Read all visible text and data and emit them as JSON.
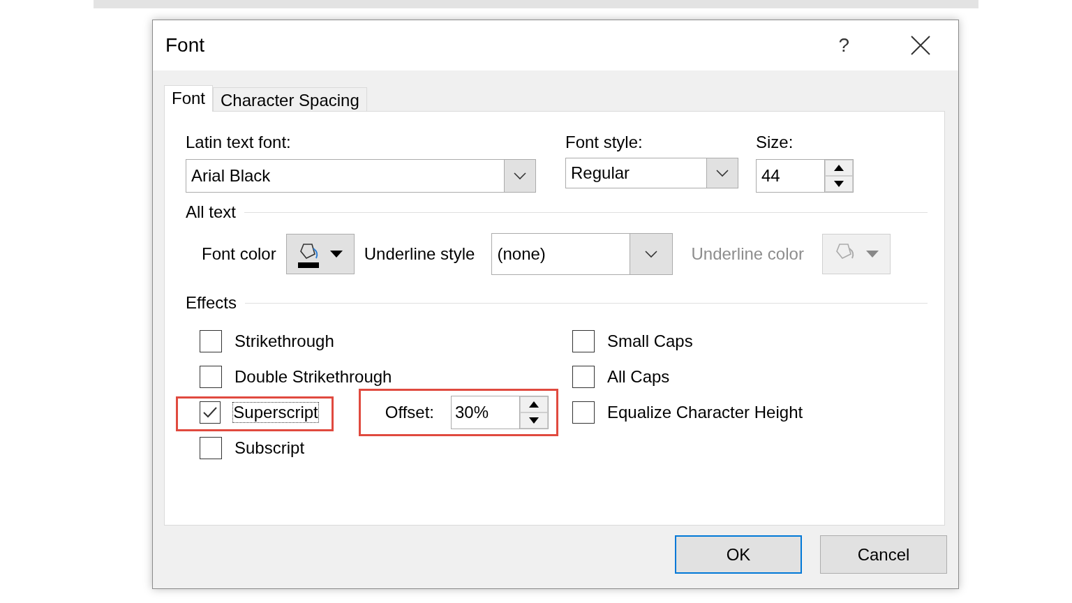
{
  "window": {
    "title": "Font",
    "help": "?"
  },
  "tabs": [
    {
      "label": "Font",
      "selected": true
    },
    {
      "label": "Character Spacing",
      "selected": false
    }
  ],
  "font": {
    "latin_label": "Latin text font:",
    "latin_value": "Arial Black",
    "style_label": "Font style:",
    "style_value": "Regular",
    "size_label": "Size:",
    "size_value": "44"
  },
  "all_text": {
    "heading": "All text",
    "font_color_label": "Font color",
    "underline_style_label": "Underline style",
    "underline_style_value": "(none)",
    "underline_color_label": "Underline color",
    "underline_color_disabled": true
  },
  "effects": {
    "heading": "Effects",
    "left": [
      {
        "label": "Strikethrough",
        "checked": false,
        "highlighted": false
      },
      {
        "label": "Double Strikethrough",
        "checked": false,
        "highlighted": false
      },
      {
        "label": "Superscript",
        "checked": true,
        "highlighted": true,
        "offset": {
          "label": "Offset:",
          "value": "30%",
          "highlighted": true
        }
      },
      {
        "label": "Subscript",
        "checked": false,
        "highlighted": false
      }
    ],
    "right": [
      {
        "label": "Small Caps",
        "checked": false,
        "highlighted": false
      },
      {
        "label": "All Caps",
        "checked": false,
        "highlighted": false
      },
      {
        "label": "Equalize Character Height",
        "checked": false,
        "highlighted": false
      }
    ]
  },
  "buttons": [
    {
      "label": "OK",
      "default": true
    },
    {
      "label": "Cancel",
      "default": false
    }
  ]
}
